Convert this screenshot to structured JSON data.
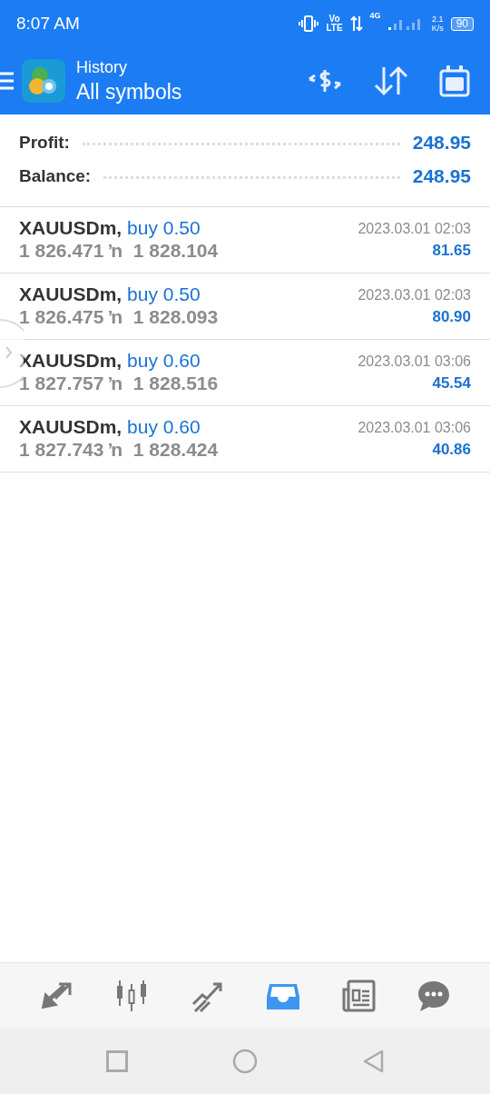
{
  "status_bar": {
    "time": "8:07 AM",
    "volte_top": "Vo",
    "volte_bottom": "LTE",
    "network": "4G",
    "speed_value": "2.1",
    "speed_unit": "K/s",
    "battery": "90"
  },
  "header": {
    "subtitle": "History",
    "title": "All symbols"
  },
  "summary": [
    {
      "label": "Profit:",
      "value": "248.95"
    },
    {
      "label": "Balance:",
      "value": "248.95"
    }
  ],
  "deals": [
    {
      "symbol": "XAUUSDm,",
      "action": "buy 0.50",
      "prices": "1 826.471 ŉ  1 828.104",
      "time": "2023.03.01 02:03",
      "profit": "81.65"
    },
    {
      "symbol": "XAUUSDm,",
      "action": "buy 0.50",
      "prices": "1 826.475 ŉ  1 828.093",
      "time": "2023.03.01 02:03",
      "profit": "80.90"
    },
    {
      "symbol": "XAUUSDm,",
      "action": "buy 0.60",
      "prices": "1 827.757 ŉ  1 828.516",
      "time": "2023.03.01 03:06",
      "profit": "45.54"
    },
    {
      "symbol": "XAUUSDm,",
      "action": "buy 0.60",
      "prices": "1 827.743 ŉ  1 828.424",
      "time": "2023.03.01 03:06",
      "profit": "40.86"
    }
  ],
  "bottom_nav": [
    {
      "kind": "quotes",
      "selected": false
    },
    {
      "kind": "chart",
      "selected": false
    },
    {
      "kind": "trade",
      "selected": false
    },
    {
      "kind": "history",
      "selected": true
    },
    {
      "kind": "news",
      "selected": false
    },
    {
      "kind": "chat",
      "selected": false
    }
  ]
}
